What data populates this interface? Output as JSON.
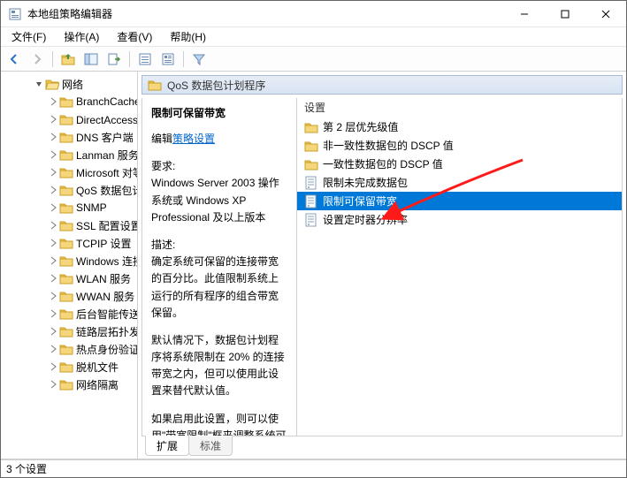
{
  "window": {
    "title": "本地组策略编辑器"
  },
  "menu": {
    "file": "文件(F)",
    "action": "操作(A)",
    "view": "查看(V)",
    "help": "帮助(H)"
  },
  "tree": {
    "root_label": "网络",
    "items": [
      "BranchCache",
      "DirectAccess 客户端",
      "DNS 客户端",
      "Lanman 服务器",
      "Microsoft 对等网络服务",
      "QoS 数据包计划程序",
      "SNMP",
      "SSL 配置设置",
      "TCPIP 设置",
      "Windows 连接管理器",
      "WLAN 服务",
      "WWAN 服务",
      "后台智能传送服务(BITS)",
      "链路层拓扑发现",
      "热点身份验证",
      "脱机文件",
      "网络隔离"
    ]
  },
  "header": {
    "title": "QoS 数据包计划程序"
  },
  "detail": {
    "title": "限制可保留带宽",
    "edit_prefix": "编辑",
    "edit_link": "策略设置",
    "req_label": "要求:",
    "req_text": "Windows Server 2003 操作系统或 Windows XP Professional 及以上版本",
    "desc_label": "描述:",
    "desc_p1": "确定系统可保留的连接带宽的百分比。此值限制系统上运行的所有程序的组合带宽保留。",
    "desc_p2": "默认情况下，数据包计划程序将系统限制在 20% 的连接带宽之内，但可以使用此设置来替代默认值。",
    "desc_p3": "如果启用此设置，则可以使用\"带宽限制\"框来调整系统可保留的带宽数量。"
  },
  "settings": {
    "header": "设置",
    "items": [
      {
        "type": "folder",
        "label": "第 2 层优先级值"
      },
      {
        "type": "folder",
        "label": "非一致性数据包的 DSCP 值"
      },
      {
        "type": "folder",
        "label": "一致性数据包的 DSCP 值"
      },
      {
        "type": "policy",
        "label": "限制未完成数据包"
      },
      {
        "type": "policy",
        "label": "限制可保留带宽",
        "selected": true
      },
      {
        "type": "policy",
        "label": "设置定时器分辨率"
      }
    ]
  },
  "tabs": {
    "extended": "扩展",
    "standard": "标准"
  },
  "status": {
    "text": "3 个设置"
  }
}
